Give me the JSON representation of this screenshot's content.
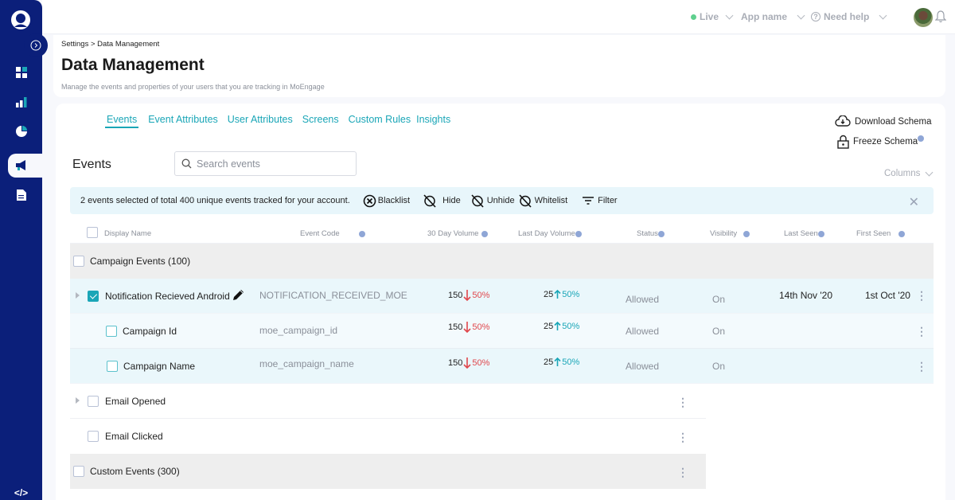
{
  "topbar": {
    "env": "Live",
    "app": "App name",
    "help": "Need help"
  },
  "header": {
    "breadcrumb": "Settings > Data Management",
    "title": "Data Management",
    "subtitle": "Manage the events and properties of your users that you are tracking in MoEngage"
  },
  "tabs": [
    {
      "label": "Events",
      "active": true
    },
    {
      "label": "Event Attributes"
    },
    {
      "label": "User Attributes"
    },
    {
      "label": "Screens"
    },
    {
      "label": "Custom Rules"
    },
    {
      "label": "Insights"
    }
  ],
  "actions": {
    "download": "Download Schema",
    "freeze": "Freeze Schema",
    "columns": "Columns"
  },
  "events_label": "Events",
  "search": {
    "placeholder": "Search events",
    "value": ""
  },
  "selection_bar": {
    "text": "2 events selected of total 400 unique events tracked for your account.",
    "blacklist": "Blacklist",
    "hide": "Hide",
    "unhide": "Unhide",
    "whitelist": "Whitelist",
    "filter": "Filter"
  },
  "columns": {
    "display_name": "Display Name",
    "event_code": "Event Code",
    "vol30": "30 Day Volume",
    "vol1": "Last Day Volume",
    "status": "Status",
    "visibility": "Visibility",
    "last_seen": "Last Seen",
    "first_seen": "First Seen"
  },
  "rows": {
    "group1": {
      "name": "Campaign Events (100)"
    },
    "event1": {
      "name": "Notification Recieved Android",
      "code": "NOTIFICATION_RECEIVED_MOE",
      "vol30": "150",
      "vol30_change": "50%",
      "vol1": "25",
      "vol1_change": "50%",
      "status": "Allowed",
      "visibility": "On",
      "last_seen": "14th Nov '20",
      "first_seen": "1st Oct '20"
    },
    "attr1": {
      "name": "Campaign Id",
      "code": "moe_campaign_id",
      "vol30": "150",
      "vol30_change": "50%",
      "vol1": "25",
      "vol1_change": "50%",
      "status": "Allowed",
      "visibility": "On"
    },
    "attr2": {
      "name": "Campaign Name",
      "code": "moe_campaign_name",
      "vol30": "150",
      "vol30_change": "50%",
      "vol1": "25",
      "vol1_change": "50%",
      "status": "Allowed",
      "visibility": "On"
    },
    "event2": {
      "name": "Email Opened"
    },
    "event3": {
      "name": "Email Clicked"
    },
    "group2": {
      "name": "Custom Events (300)"
    }
  },
  "colors": {
    "sidebar": "#0b1f7a",
    "accent": "#1aa6b7",
    "down": "#e0474c",
    "live": "#5fd08e"
  }
}
